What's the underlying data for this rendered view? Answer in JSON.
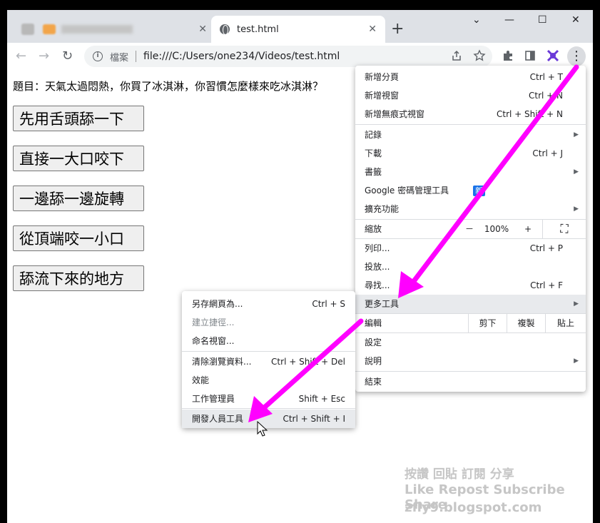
{
  "tabs": {
    "inactive_title": "Blogger 上傳",
    "active_title": "test.html",
    "close_symbol": "✕",
    "new_tab_symbol": "+"
  },
  "window_controls": {
    "dropdown": "⌄",
    "minimize": "—",
    "maximize": "☐",
    "close": "✕"
  },
  "toolbar": {
    "back": "←",
    "forward": "→",
    "reload": "↻",
    "site_info_label": "檔案",
    "url": "file:///C:/Users/one234/Videos/test.html",
    "menu_symbol": "⋮"
  },
  "page": {
    "question": "題目：天氣太過悶熱，你買了冰淇淋，你習慣怎麼樣來吃冰淇淋？",
    "answers": [
      "先用舌頭舔一下",
      "直接一大口咬下",
      "一邊舔一邊旋轉",
      "從頂端咬一小口",
      "舔流下來的地方"
    ]
  },
  "menu": {
    "new_tab": "新增分頁",
    "new_tab_sc": "Ctrl + T",
    "new_window": "新增視窗",
    "new_window_sc": "Ctrl + N",
    "incognito": "新增無痕式視窗",
    "incognito_sc": "Ctrl + Shift + N",
    "history": "記錄",
    "downloads": "下載",
    "downloads_sc": "Ctrl + J",
    "bookmarks": "書籤",
    "passwords": "Google 密碼管理工具",
    "passwords_badge": "新",
    "extensions": "擴充功能",
    "zoom": "縮放",
    "zoom_minus": "－",
    "zoom_value": "100%",
    "zoom_plus": "+",
    "fullscreen": "⛶",
    "print": "列印...",
    "print_sc": "Ctrl + P",
    "cast": "投放...",
    "find": "尋找...",
    "find_sc": "Ctrl + F",
    "more_tools": "更多工具",
    "edit": "編輯",
    "cut": "剪下",
    "copy": "複製",
    "paste": "貼上",
    "settings": "設定",
    "help": "說明",
    "exit": "結束",
    "arrow": "▶"
  },
  "submenu": {
    "save_page": "另存網頁為...",
    "save_page_sc": "Ctrl + S",
    "create_shortcut": "建立捷徑...",
    "name_window": "命名視窗...",
    "clear_data": "清除瀏覽資料...",
    "clear_data_sc": "Ctrl + Shift + Del",
    "performance": "效能",
    "task_manager": "工作管理員",
    "task_manager_sc": "Shift + Esc",
    "dev_tools": "開發人員工具",
    "dev_tools_sc": "Ctrl + Shift + I"
  },
  "watermark": {
    "line1": "按讚 回貼 訂閱 分享",
    "line2": "Like Repost Subscribe Share",
    "line3": "zfly9.blogspot.com"
  },
  "colors": {
    "arrow": "#ff00ff",
    "badge": "#1a73e8"
  },
  "icons": [
    "globe-icon",
    "info-icon",
    "share-icon",
    "star-icon",
    "extensions-icon",
    "sidepanel-icon",
    "profile-icon",
    "mouse-cursor-icon"
  ]
}
